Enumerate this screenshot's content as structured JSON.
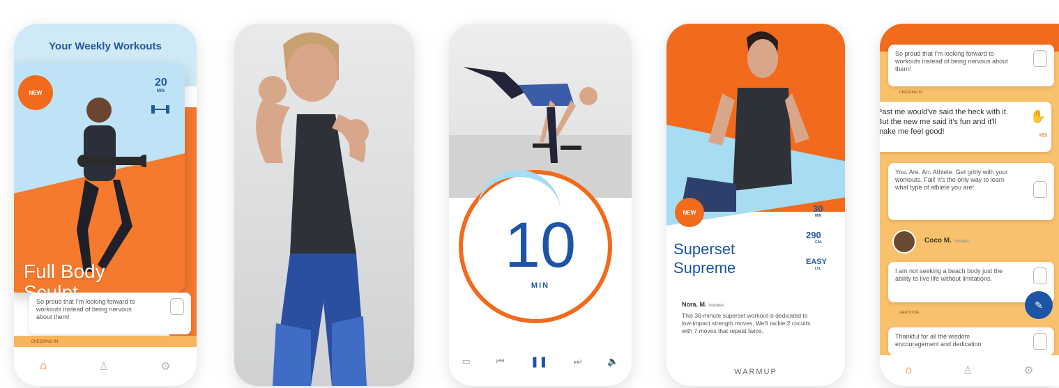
{
  "phone1": {
    "header_title": "Your Weekly Workouts",
    "badge": "NEW",
    "minutes": "20",
    "minutes_unit": "MIN",
    "workout_name": "Full Body Sculpt",
    "comment_text": "So proud that I'm looking forward to workouts instead of being nervous about them!",
    "comment_meta": "CHECKING IN",
    "nav": [
      "home-icon",
      "profile-icon",
      "settings-icon"
    ]
  },
  "phone3": {
    "timer_value": "10",
    "timer_unit": "MIN",
    "controls": [
      "cast-icon",
      "previous-icon",
      "pause-icon",
      "next-icon",
      "volume-icon"
    ]
  },
  "phone4": {
    "badge": "NEW",
    "stats": [
      {
        "value": "30",
        "unit": "MIN"
      },
      {
        "value": "290",
        "unit": "CAL"
      },
      {
        "value": "EASY",
        "unit": "LVL"
      }
    ],
    "workout_name_line1": "Superset",
    "workout_name_line2": "Supreme",
    "trainer": "Nora. M.",
    "trainer_tag": "TRAINER",
    "description": "This 30-minute superset workout is dedicated to low-impact strength moves. We'll tackle 2 circuits with 7 moves that repeat twice.",
    "footer_label": "WARMUP"
  },
  "phone5": {
    "comments": [
      {
        "text": "So proud that I'm looking forward to workouts instead of being nervous about them!",
        "meta": "CHECKING IN"
      },
      {
        "text": "Past me would've said the heck with it. But the new me said it's fun and it'll make me feel good!",
        "meta": "YES"
      },
      {
        "text": "You. Are. An. Athlete. Get gritty with your workouts. Fail! It's the only way to learn what type of athlete you are!",
        "meta": ""
      },
      {
        "text": "I am not seeking a beach body just the ability to live life without limitations.",
        "meta": "GRATITUDE"
      },
      {
        "text": "Thankful for all the wisdom encouragement and dedication",
        "meta": ""
      }
    ],
    "coach_name": "Coco M.",
    "coach_tag": "TRAINER",
    "nav": [
      "home-icon",
      "profile-icon",
      "settings-icon"
    ],
    "fab_icon": "pencil-icon"
  },
  "colors": {
    "orange": "#f26a1b",
    "blue": "#1d54a6",
    "light_blue": "#a8dcf2"
  }
}
